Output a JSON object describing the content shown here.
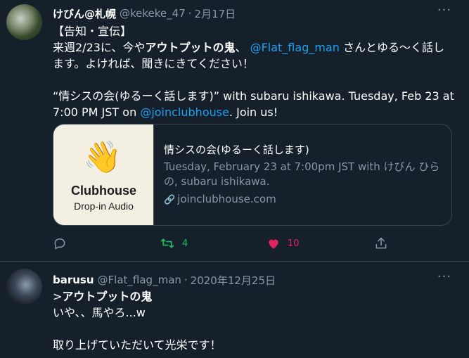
{
  "tweet1": {
    "name": "けびん@札幌",
    "handle": "@kekeke_47",
    "separator": "·",
    "time": "2月17日",
    "more": "···",
    "lines": {
      "l1": "【告知・宣伝】",
      "l2a": "来週2/23に、今や",
      "l2b": "アウトプットの鬼",
      "l2c": "、",
      "l2d": "@Flat_flag_man",
      "l2e": " さんとゆる〜く話し",
      "l3": "ます。よければ、聞きにきてください！",
      "l5": "“情シスの会(ゆるーく話します)” with subaru ishikawa. Tuesday, Feb 23 at",
      "l6a": "7:00 PM JST on ",
      "l6b": "@joinclubhouse",
      "l6c": ". Join us!"
    },
    "card": {
      "image_title": "Clubhouse",
      "image_subtitle": "Drop-in Audio",
      "image_icon": "waving-hand-icon",
      "title": "情シスの会(ゆるーく話します)",
      "desc_line1": "Tuesday, February 23 at 7:00pm JST with けびん ひら",
      "desc_line2": "の, subaru ishikawa.",
      "link": "joinclubhouse.com"
    },
    "actions": {
      "retweets": "4",
      "likes": "10"
    }
  },
  "tweet2": {
    "name": "barusu",
    "handle": "@Flat_flag_man",
    "separator": "·",
    "time": "2020年12月25日",
    "more": "···",
    "lines": {
      "l1a": ">",
      "l1b": "アウトプットの鬼",
      "l2": "いや、、馬やろ...w",
      "l4": "取り上げていただいて光栄です！"
    }
  },
  "colors": {
    "background": "#15202b",
    "text": "#ffffff",
    "muted": "#8899a6",
    "link": "#1da1f2",
    "retweet": "#17bf63",
    "like": "#e0245e"
  }
}
